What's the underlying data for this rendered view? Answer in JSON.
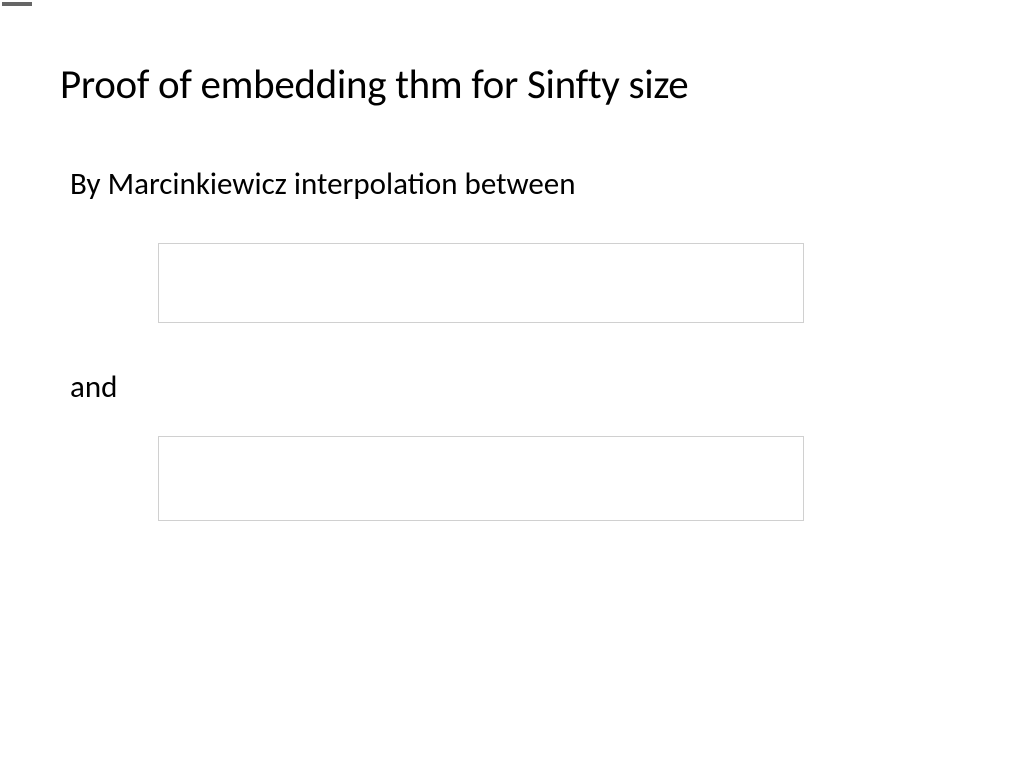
{
  "slide": {
    "title": "Proof of embedding thm for Sinfty size",
    "line1": "By Marcinkiewicz interpolation between",
    "line2": "and"
  }
}
